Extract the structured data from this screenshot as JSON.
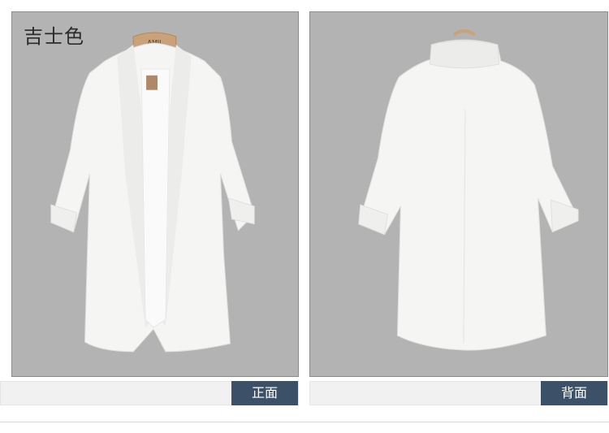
{
  "color_name": "吉士色",
  "hanger_tag_text": "AMII",
  "views": {
    "front_label": "正面",
    "back_label": "背面"
  },
  "colors": {
    "photo_background": "#b3b3b3",
    "garment": "#f5f5f3",
    "tag_background": "#3c5068",
    "bar_background": "#f1f1f1"
  }
}
